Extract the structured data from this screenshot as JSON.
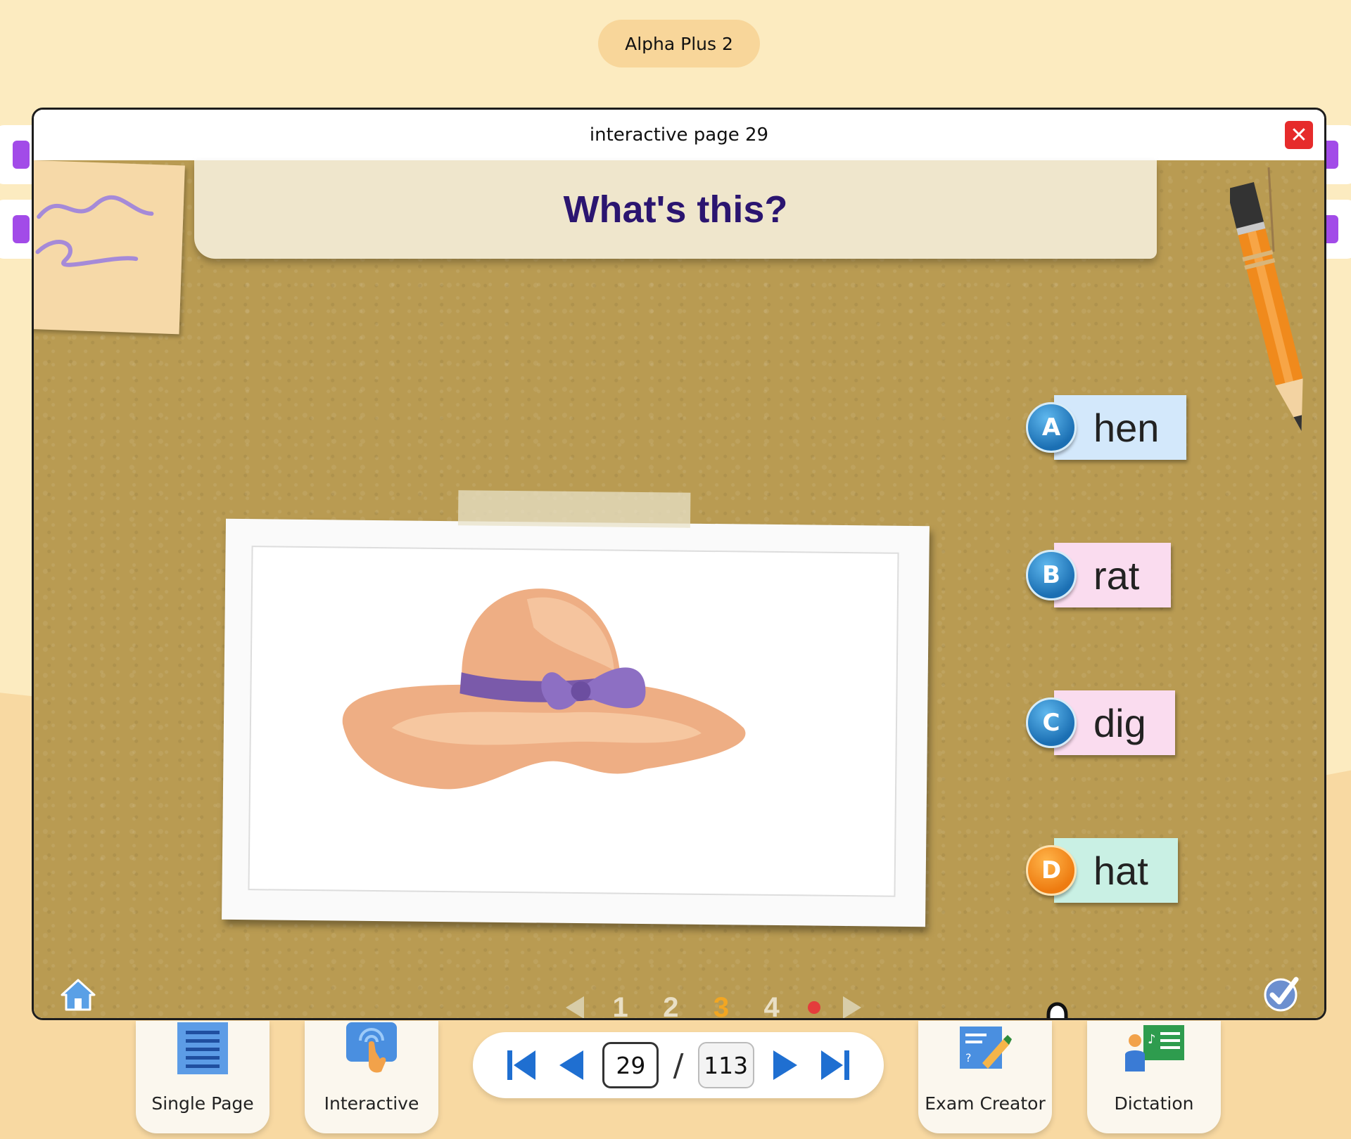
{
  "book": {
    "title": "Alpha Plus 2"
  },
  "modal": {
    "title": "interactive page 29",
    "close_icon": "close-icon"
  },
  "question": {
    "text": "What's this?"
  },
  "options": [
    {
      "letter": "A",
      "word": "hen",
      "card_color": "#d3e8fb"
    },
    {
      "letter": "B",
      "word": "rat",
      "card_color": "#fadcef"
    },
    {
      "letter": "C",
      "word": "dig",
      "card_color": "#fadcef"
    },
    {
      "letter": "D",
      "word": "hat",
      "card_color": "#c9f0e4"
    }
  ],
  "pager": {
    "pages": [
      "1",
      "2",
      "3",
      "4"
    ],
    "active_page": "3"
  },
  "toolbar": {
    "single_page_label": "Single Page",
    "interactive_label": "Interactive",
    "exam_creator_label": "Exam Creator",
    "dictation_label": "Dictation"
  },
  "navigation": {
    "current_page": "29",
    "separator": "/",
    "total_pages": "113"
  },
  "colors": {
    "accent": "#1f6fd1",
    "question": "#2b1570",
    "active_page": "#f2a622",
    "close": "#e62b2b"
  }
}
